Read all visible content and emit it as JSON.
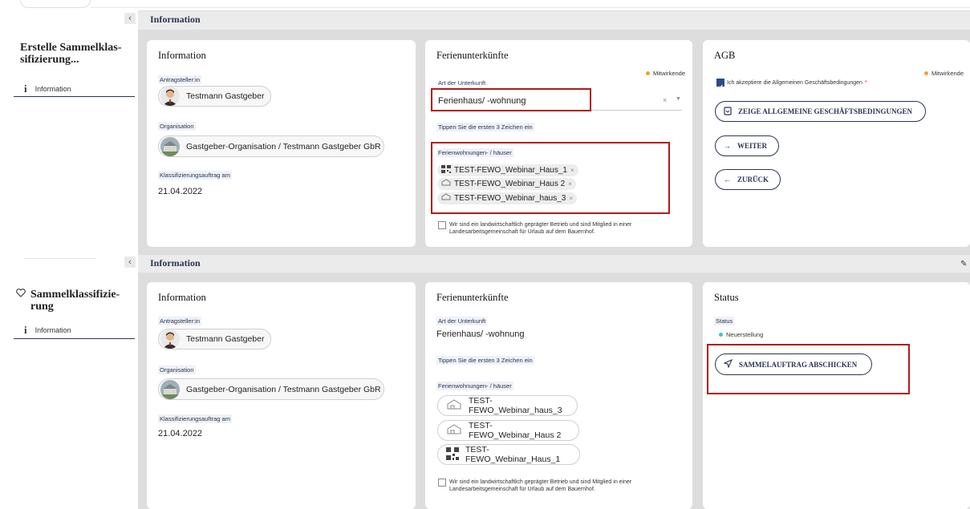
{
  "top": {
    "sidebar": {
      "collapse_icon": "‹",
      "title": "Erstelle Sammelklas-sifizierung...",
      "nav_item": "Information"
    },
    "header_title": "Information",
    "information_card": {
      "title": "Information",
      "applicant_label": "Antragsteller:in",
      "applicant_name": "Testmann Gastgeber",
      "organisation_label": "Organisation",
      "organisation_name": "Gastgeber-Organisation / Testmann Gastgeber GbR",
      "date_label": "Klassifizierungsauftrag am",
      "date_value": "21.04.2022"
    },
    "accommodation_card": {
      "title": "Ferienunterkünfte",
      "badge": "Mitwirkende",
      "type_label": "Art der Unterkunft",
      "type_value": "Ferienhaus/ -wohnung",
      "hint": "Tippen Sie die ersten 3 Zeichen ein",
      "houses_label": "Ferienwohnungen- / häuser",
      "houses": [
        "TEST-FEWO_Webinar_Haus_1",
        "TEST-FEWO_Webinar_Haus 2",
        "TEST-FEWO_Webinar_haus_3"
      ],
      "farm_text": "Wir sind ein landwirtschaftlich geprägter Betrieb und sind Mitglied in einer Landesarbeitsgemeinschaft für Urlaub auf dem Bauernhof."
    },
    "agb_card": {
      "title": "AGB",
      "badge": "Mitwirkende",
      "accept_text": "Ich akzeptiere die Allgemeinen Geschäftsbedingungen",
      "required_mark": "*",
      "show_terms_button": "ZEIGE ALLGEMEINE GESCHÄFTSBEDINGUNGEN",
      "next_button": "WEITER",
      "back_button": "ZURÜCK"
    }
  },
  "bottom": {
    "sidebar": {
      "collapse_icon": "‹",
      "title": "Sammelklassifizie-rung",
      "nav_item": "Information"
    },
    "header_title": "Information",
    "information_card": {
      "title": "Information",
      "applicant_label": "Antragsteller:in",
      "applicant_name": "Testmann Gastgeber",
      "organisation_label": "Organisation",
      "organisation_name": "Gastgeber-Organisation / Testmann Gastgeber GbR",
      "date_label": "Klassifizierungsauftrag am",
      "date_value": "21.04.2022"
    },
    "accommodation_card": {
      "title": "Ferienunterkünfte",
      "type_label": "Art der Unterkunft",
      "type_value": "Ferienhaus/ -wohnung",
      "hint": "Tippen Sie die ersten 3 Zeichen ein",
      "houses_label": "Ferienwohnungen- / häuser",
      "houses": [
        "TEST-FEWO_Webinar_haus_3",
        "TEST-FEWO_Webinar_Haus 2",
        "TEST-FEWO_Webinar_Haus_1"
      ],
      "farm_text": "Wir sind ein landwirtschaftlich geprägter Betrieb und sind Mitglied in einer Landesarbeitsgemeinschaft für Urlaub auf dem Bauernhof."
    },
    "status_card": {
      "title": "Status",
      "status_label": "Status",
      "status_value": "Neuerstellung",
      "submit_button": "SAMMELAUFTRAG ABSCHICKEN"
    }
  },
  "colors": {
    "accent": "#2a3550",
    "highlight_box": "#b01c1c",
    "badge_orange": "#f0a030",
    "status_teal": "#3cc8c0"
  }
}
